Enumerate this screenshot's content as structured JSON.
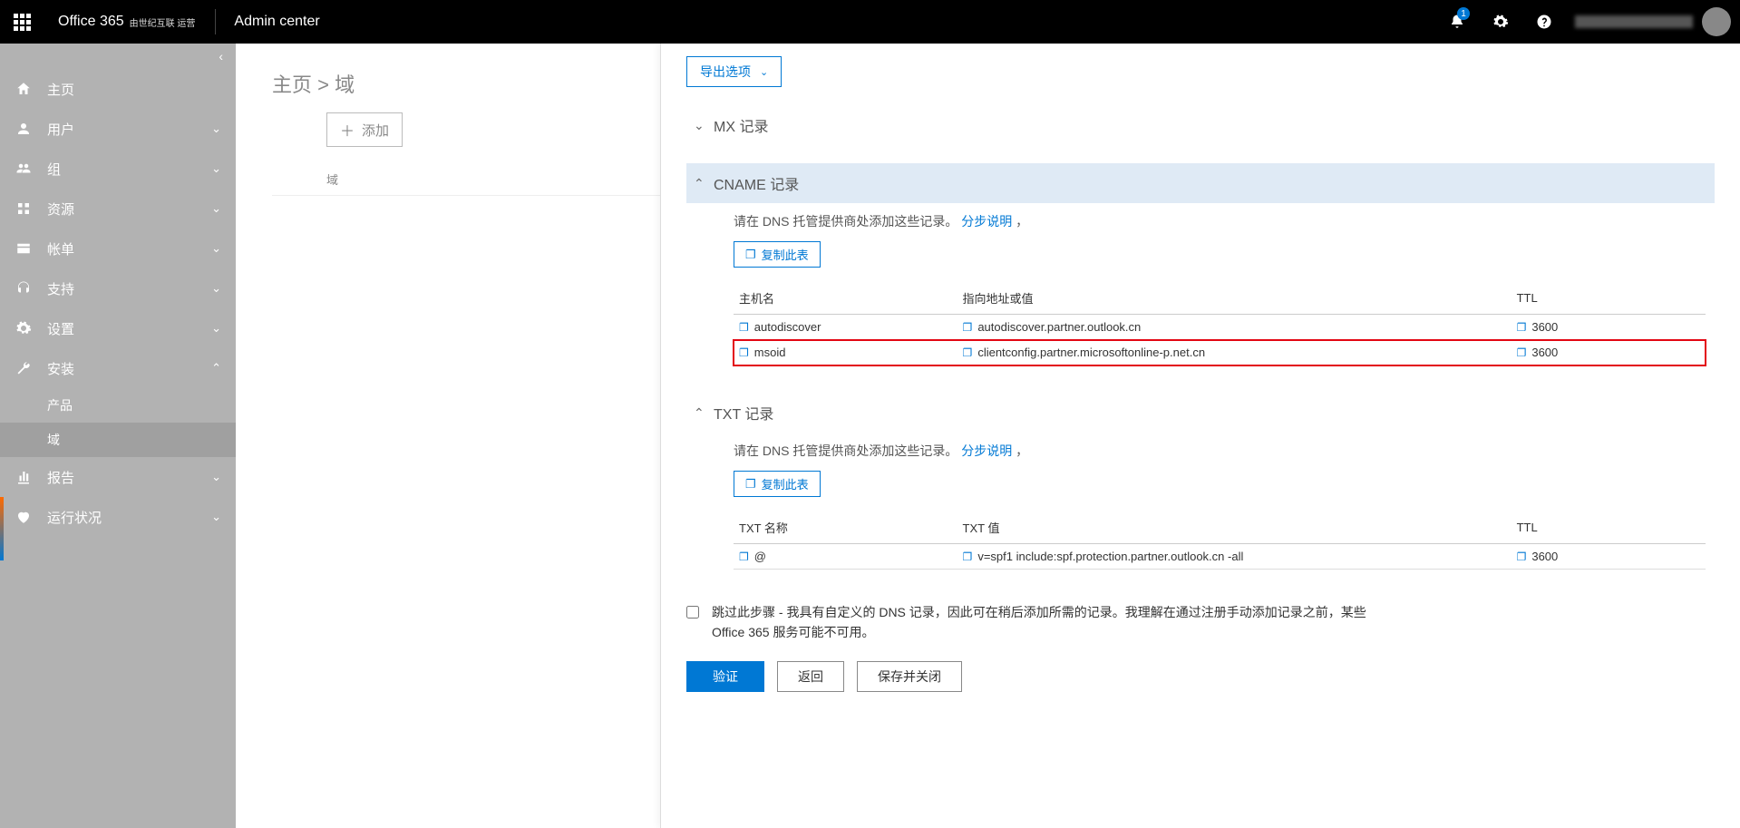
{
  "suitebar": {
    "brand": "Office 365",
    "brand_operator": "由世纪互联 运营",
    "app_title": "Admin center",
    "notification_count": "1"
  },
  "sidebar": {
    "items": [
      {
        "label": "主页",
        "expandable": false
      },
      {
        "label": "用户",
        "expandable": true
      },
      {
        "label": "组",
        "expandable": true
      },
      {
        "label": "资源",
        "expandable": true
      },
      {
        "label": "帐单",
        "expandable": true
      },
      {
        "label": "支持",
        "expandable": true
      },
      {
        "label": "设置",
        "expandable": true
      },
      {
        "label": "安装",
        "expandable": true,
        "open": true,
        "children": [
          {
            "label": "产品"
          },
          {
            "label": "域",
            "active": true
          }
        ]
      },
      {
        "label": "报告",
        "expandable": true
      },
      {
        "label": "运行状况",
        "expandable": true
      }
    ]
  },
  "main": {
    "breadcrumb_home": "主页",
    "breadcrumb_sep": " > ",
    "breadcrumb_current": "域",
    "add_label": "添加",
    "col_domain": "域"
  },
  "panel": {
    "export_label": "导出选项",
    "sections": {
      "mx": {
        "title": "MX 记录"
      },
      "cname": {
        "title": "CNAME 记录",
        "help_prefix": "请在 DNS 托管提供商处添加这些记录。",
        "help_link": "分步说明",
        "copy_label": "复制此表",
        "cols": {
          "host": "主机名",
          "target": "指向地址或值",
          "ttl": "TTL"
        },
        "rows": [
          {
            "host": "autodiscover",
            "target": "autodiscover.partner.outlook.cn",
            "ttl": "3600"
          },
          {
            "host": "msoid",
            "target": "clientconfig.partner.microsoftonline-p.net.cn",
            "ttl": "3600",
            "highlight": true
          }
        ]
      },
      "txt": {
        "title": "TXT 记录",
        "help_prefix": "请在 DNS 托管提供商处添加这些记录。",
        "help_link": "分步说明",
        "copy_label": "复制此表",
        "cols": {
          "name": "TXT 名称",
          "value": "TXT 值",
          "ttl": "TTL"
        },
        "rows": [
          {
            "name": "@",
            "value": "v=spf1 include:spf.protection.partner.outlook.cn -all",
            "ttl": "3600"
          }
        ]
      }
    },
    "skip_text": "跳过此步骤 - 我具有自定义的 DNS 记录，因此可在稍后添加所需的记录。我理解在通过注册手动添加记录之前，某些 Office 365 服务可能不可用。",
    "btn_verify": "验证",
    "btn_back": "返回",
    "btn_save_close": "保存并关闭"
  }
}
